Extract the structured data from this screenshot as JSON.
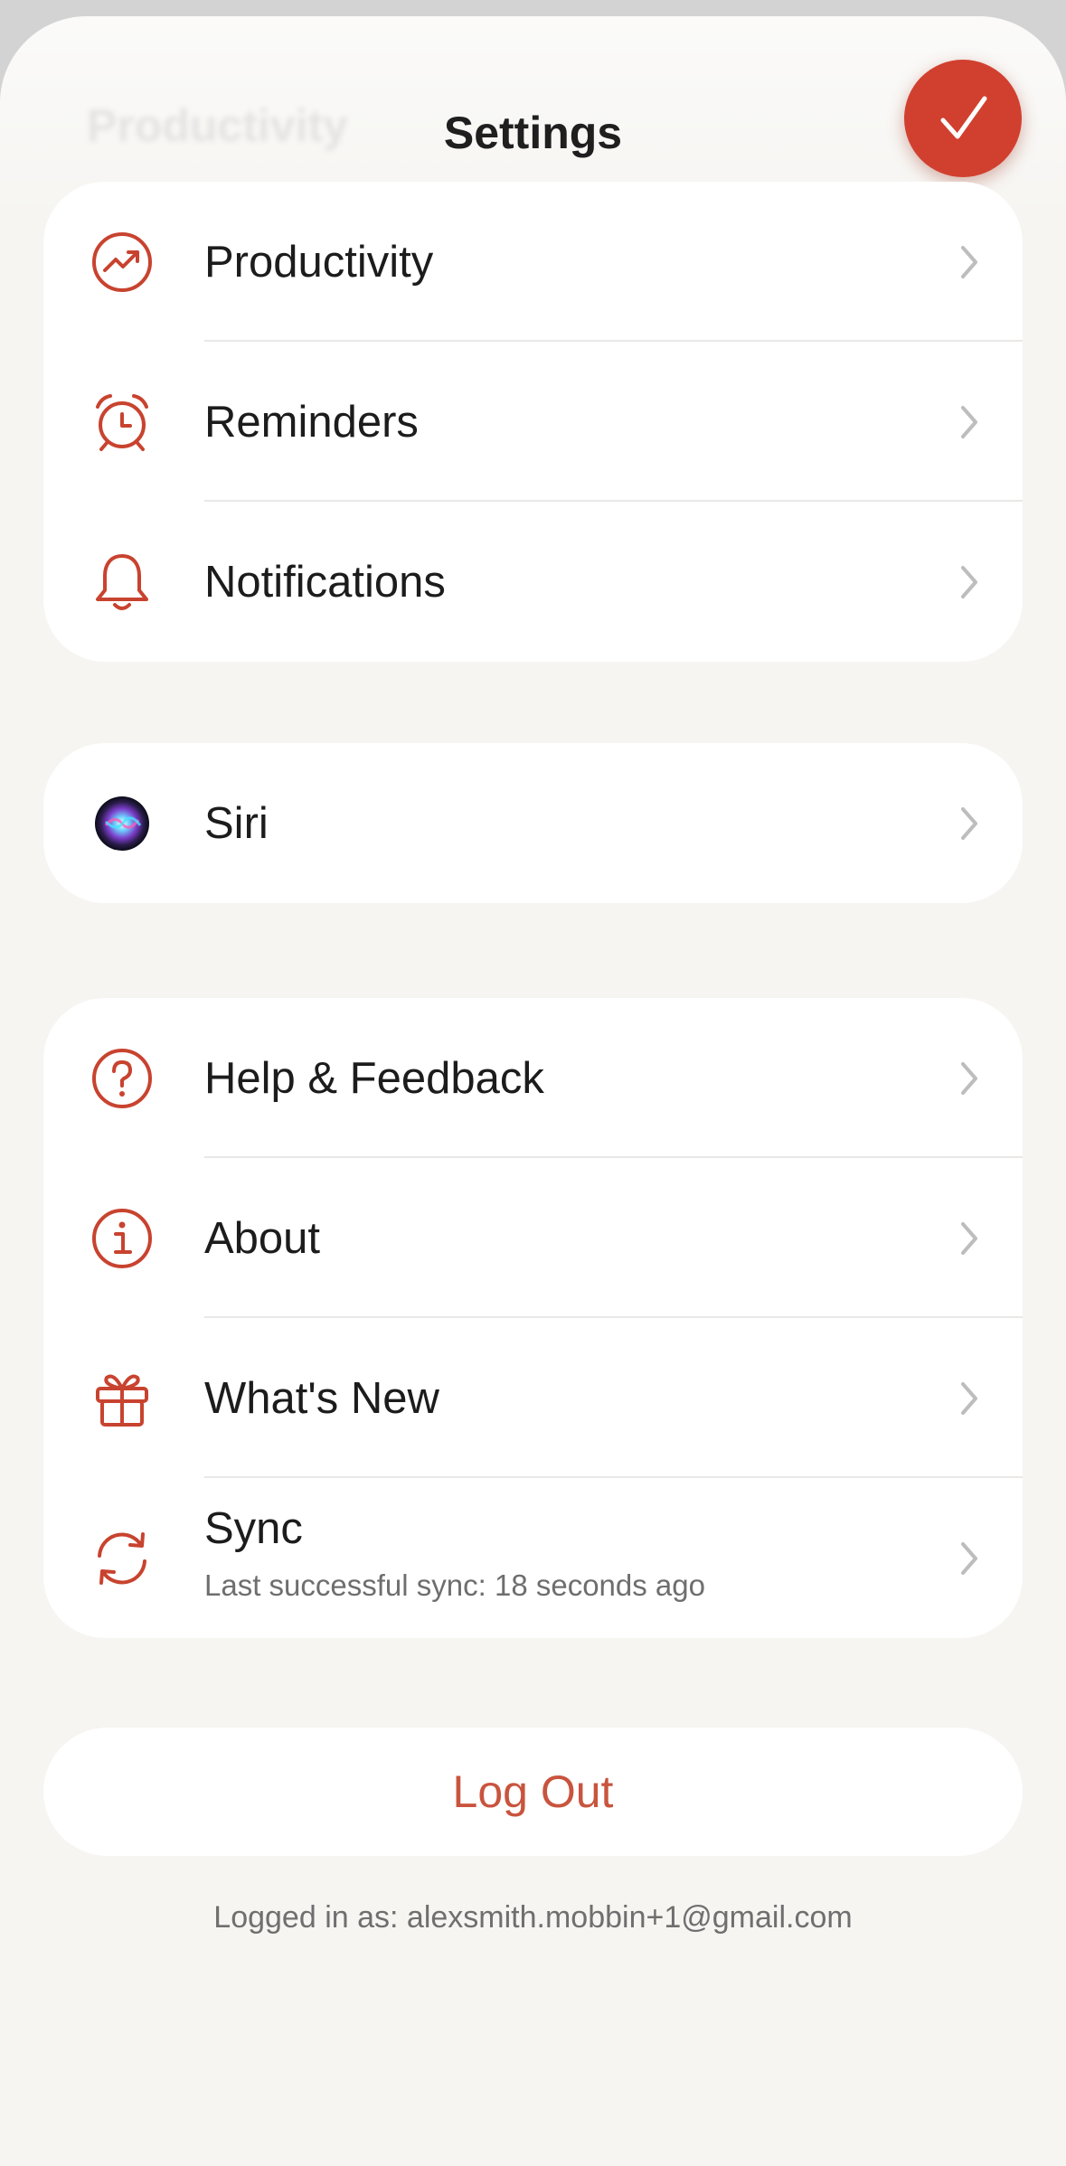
{
  "header": {
    "title": "Settings",
    "ghost_title": "Productivity",
    "done_icon": "checkmark-icon",
    "accent_color": "#d1402f"
  },
  "group1": [
    {
      "label": "Productivity",
      "icon": "trending-up-icon"
    },
    {
      "label": "Reminders",
      "icon": "alarm-clock-icon"
    },
    {
      "label": "Notifications",
      "icon": "bell-icon"
    }
  ],
  "group2": [
    {
      "label": "Siri",
      "icon": "siri-icon"
    }
  ],
  "group3": [
    {
      "label": "Help & Feedback",
      "icon": "question-circle-icon"
    },
    {
      "label": "About",
      "icon": "info-circle-icon"
    },
    {
      "label": "What's New",
      "icon": "gift-icon"
    },
    {
      "label": "Sync",
      "sublabel": "Last successful sync: 18 seconds ago",
      "icon": "sync-icon"
    }
  ],
  "logout": {
    "label": "Log Out"
  },
  "footer": {
    "logged_in_text": "Logged in as: alexsmith.mobbin+1@gmail.com"
  }
}
